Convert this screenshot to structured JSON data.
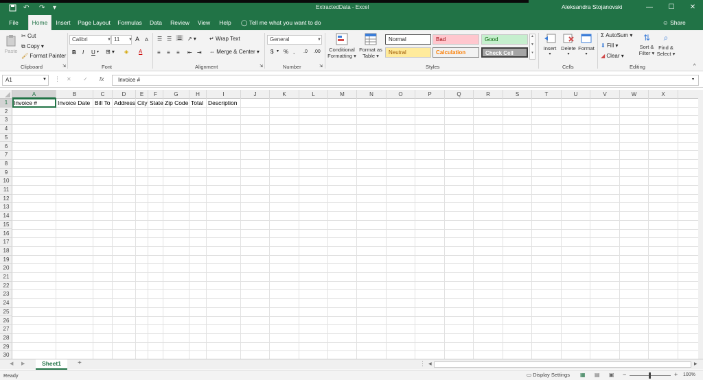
{
  "window": {
    "title": "ExtractedData  -  Excel",
    "user": "Aleksandra Stojanovski",
    "minimize": "—",
    "restore": "☐",
    "close": "✕"
  },
  "tabs": [
    "File",
    "Home",
    "Insert",
    "Page Layout",
    "Formulas",
    "Data",
    "Review",
    "View",
    "Help"
  ],
  "tell_me": "Tell me what you want to do",
  "share": "Share",
  "ribbon": {
    "clipboard": {
      "label": "Clipboard",
      "paste": "Paste",
      "cut": "Cut",
      "copy": "Copy",
      "format_painter": "Format Painter"
    },
    "font": {
      "label": "Font",
      "family": "Calibri",
      "size": "11",
      "grow": "A",
      "shrink": "A",
      "bold": "B",
      "italic": "I",
      "underline": "U",
      "font_color_letter": "A"
    },
    "alignment": {
      "label": "Alignment",
      "wrap_text": "Wrap Text",
      "merge_center": "Merge & Center"
    },
    "number": {
      "label": "Number",
      "format": "General",
      "currency": "$",
      "percent": "%"
    },
    "styles": {
      "label": "Styles",
      "conditional": [
        "Conditional",
        "Formatting"
      ],
      "format_as_table": [
        "Format as",
        "Table"
      ],
      "normal": "Normal",
      "bad": "Bad",
      "good": "Good",
      "neutral": "Neutral",
      "calculation": "Calculation",
      "check_cell": "Check Cell"
    },
    "cells": {
      "label": "Cells",
      "insert": "Insert",
      "delete": "Delete",
      "format": "Format"
    },
    "editing": {
      "label": "Editing",
      "autosum": "AutoSum",
      "fill": "Fill",
      "clear": "Clear",
      "sort_filter": [
        "Sort &",
        "Filter"
      ],
      "find_select": [
        "Find &",
        "Select"
      ]
    }
  },
  "formula_bar": {
    "name_box": "A1",
    "fx": "fx",
    "cancel": "✕",
    "enter": "✓",
    "content": "Invoice #"
  },
  "columns": [
    "A",
    "B",
    "C",
    "D",
    "E",
    "F",
    "G",
    "H",
    "I",
    "J",
    "K",
    "L",
    "M",
    "N",
    "O",
    "P",
    "Q",
    "R",
    "S",
    "T",
    "U",
    "V",
    "W",
    "X"
  ],
  "rows": [
    "1",
    "2",
    "3",
    "4",
    "5",
    "6",
    "7",
    "8",
    "9",
    "10",
    "11",
    "12",
    "13",
    "14",
    "15",
    "16",
    "17",
    "18",
    "19",
    "20",
    "21",
    "22",
    "23",
    "24",
    "25",
    "26",
    "27",
    "28",
    "29",
    "30"
  ],
  "row1": [
    "Invoice #",
    "Invoice Date",
    "Bill To",
    "Address",
    "City",
    "State",
    "Zip Code",
    "Total",
    "Description"
  ],
  "sheet_tab": "Sheet1",
  "add_sheet": "+",
  "status": {
    "ready": "Ready",
    "display_settings": "Display Settings",
    "zoom": "100%"
  },
  "colors": {
    "excel_green": "#217346",
    "bad_bg": "#ffc7ce",
    "bad_fg": "#9c0006",
    "good_bg": "#c6efce",
    "good_fg": "#006100",
    "neutral_bg": "#ffeb9c",
    "neutral_fg": "#9c5700",
    "calc_fg": "#fa7d00",
    "check_bg": "#a5a5a5"
  }
}
